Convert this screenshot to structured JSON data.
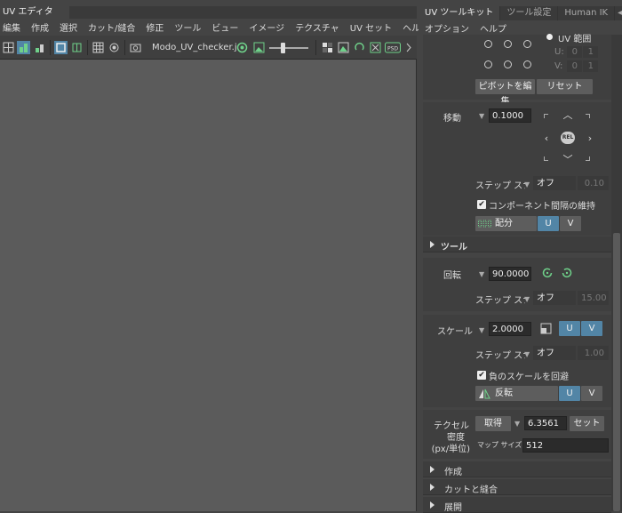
{
  "uv_editor": {
    "title": "UV エディタ",
    "menu": [
      "編集",
      "作成",
      "選択",
      "カット/縫合",
      "修正",
      "ツール",
      "ビュー",
      "イメージ",
      "テクスチャ",
      "UV セット",
      "ヘルプ"
    ],
    "texture_name": "Modo_UV_checker.j"
  },
  "panel": {
    "tabs": [
      "UV ツールキット",
      "ツール設定",
      "Human IK"
    ],
    "menu": [
      "オプション",
      "ヘルプ"
    ],
    "pivot": {
      "uv_range_label": "UV 範囲",
      "u_label": "U:",
      "u_val": "0",
      "u_val2": "1",
      "v_label": "V:",
      "v_val": "0",
      "v_val2": "1",
      "edit_pivot": "ピボットを編集",
      "reset": "リセット"
    },
    "move": {
      "label": "移動",
      "value": "0.1000",
      "rel": "REL",
      "step_snap": "ステップ スナップ",
      "snap_value": "オフ",
      "snap_dim": "0.10",
      "keep_spacing": "コンポーネント間隔の維持",
      "distribute": "配分",
      "u": "U",
      "v": "V"
    },
    "tools_header": "ツール",
    "rotate": {
      "label": "回転",
      "value": "90.0000",
      "step_snap": "ステップ スナップ",
      "snap_value": "オフ",
      "snap_dim": "15.00"
    },
    "scale": {
      "label": "スケール",
      "value": "2.0000",
      "u": "U",
      "v": "V",
      "step_snap": "ステップ スナップ",
      "snap_value": "オフ",
      "snap_dim": "1.00",
      "avoid_negative": "負のスケールを回避",
      "flip": "反転",
      "flip_u": "U",
      "flip_v": "V"
    },
    "texel": {
      "label1": "テクセル",
      "label2": "密度",
      "label3": "(px/単位)",
      "get": "取得",
      "value": "6.3561",
      "set": "セット",
      "map_size_label": "マップ サイズ:",
      "map_size": "512"
    },
    "sections": [
      "作成",
      "カットと縫合",
      "展開"
    ]
  },
  "colors": {
    "accent": "#5285a6",
    "viewport": "#5b5b5b",
    "panel": "#444444",
    "field": "#2b2b2b"
  },
  "slider_fraction": 0.35
}
